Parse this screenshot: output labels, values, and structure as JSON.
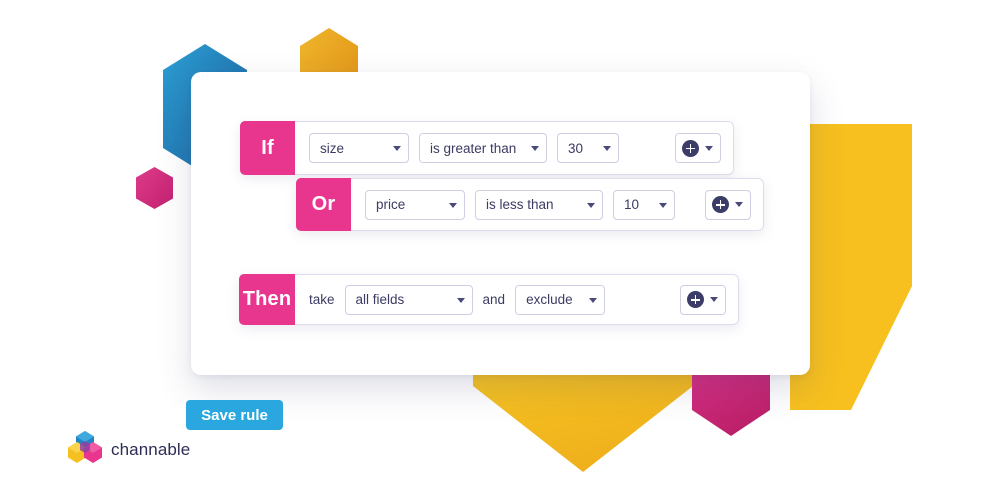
{
  "brand": {
    "name": "channable",
    "logo_icon": "channable-hexagons-logo",
    "colors": {
      "pink": "#E8368F",
      "yellow": "#F5C122",
      "blue": "#2185C5",
      "navy": "#3C3C68",
      "button_blue": "#2BA7E0"
    }
  },
  "rule_builder": {
    "rows": [
      {
        "tag": "If",
        "type": "condition",
        "fields": [
          {
            "kind": "select",
            "name": "field",
            "value": "size"
          },
          {
            "kind": "select",
            "name": "operator",
            "value": "is greater than"
          },
          {
            "kind": "select",
            "name": "value",
            "value": "30"
          }
        ],
        "add_button": {
          "icon": "plus-icon",
          "caret": "chevron-down-icon"
        }
      },
      {
        "tag": "Or",
        "type": "condition",
        "fields": [
          {
            "kind": "select",
            "name": "field",
            "value": "price"
          },
          {
            "kind": "select",
            "name": "operator",
            "value": "is less than"
          },
          {
            "kind": "select",
            "name": "value",
            "value": "10"
          }
        ],
        "add_button": {
          "icon": "plus-icon",
          "caret": "chevron-down-icon"
        }
      },
      {
        "tag": "Then",
        "type": "action",
        "label_take": "take",
        "label_and": "and",
        "fields": [
          {
            "kind": "select",
            "name": "target-fields",
            "value": "all fields"
          },
          {
            "kind": "select",
            "name": "action",
            "value": "exclude"
          }
        ],
        "add_button": {
          "icon": "plus-icon",
          "caret": "chevron-down-icon"
        }
      }
    ]
  },
  "actions": {
    "save_label": "Save rule"
  },
  "decorations": [
    {
      "name": "hexagon-blue-top-left",
      "color": "#2185C5"
    },
    {
      "name": "hexagon-yellow-top",
      "color": "#E8AE1E"
    },
    {
      "name": "hexagon-pink-small-left",
      "color": "#D9317F"
    },
    {
      "name": "hexagon-yellow-right-large",
      "color": "#F7C01F"
    },
    {
      "name": "hexagon-yellow-bottom",
      "color": "#F5C122"
    },
    {
      "name": "hexagon-pink-bottom-right",
      "color": "#D9317F"
    }
  ]
}
